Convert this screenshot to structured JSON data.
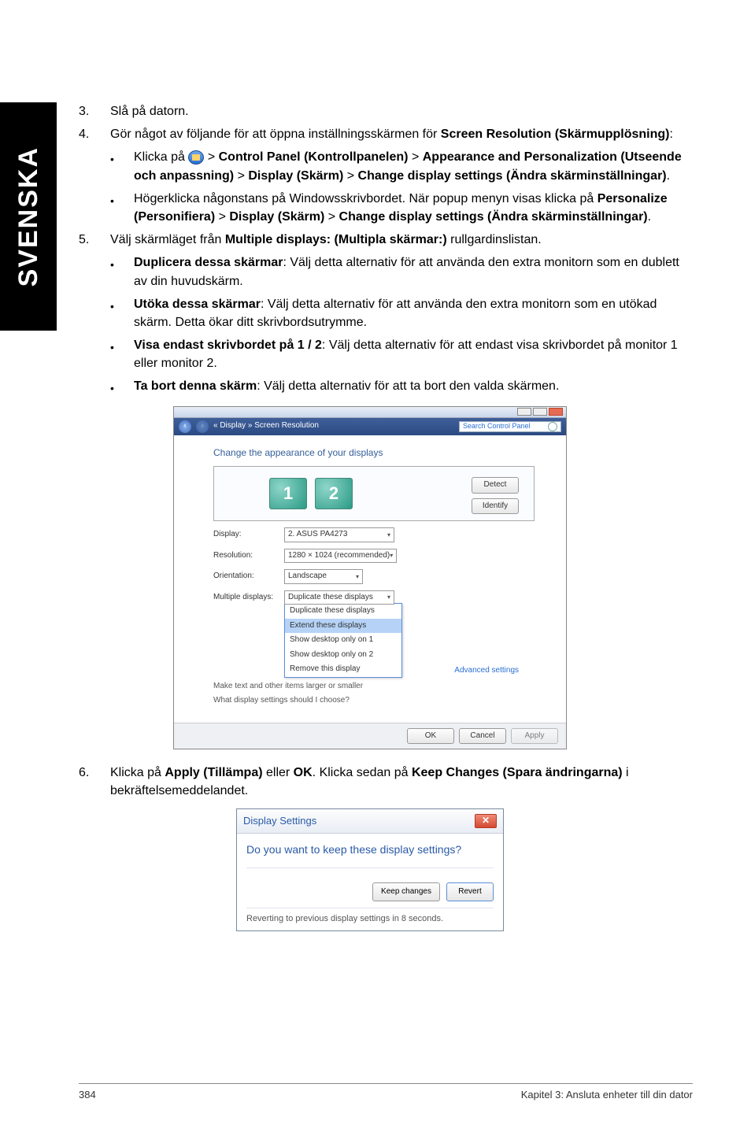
{
  "side_label": "SVENSKA",
  "list": {
    "n3": "3.",
    "t3": "Slå på datorn.",
    "n4": "4.",
    "t4_a": "Gör något av följande för att öppna inställningsskärmen för ",
    "t4_b": "Screen Resolution (Skärmupplösning)",
    "t4_c": ":",
    "b4_1_a": "Klicka på ",
    "b4_1_b": " > ",
    "b4_1_c": "Control Panel (Kontrollpanelen)",
    "b4_1_d": " > ",
    "b4_1_e": "Appearance and Personalization (Utseende och anpassning)",
    "b4_1_f": " > ",
    "b4_1_g": "Display (Skärm)",
    "b4_1_h": " > ",
    "b4_1_i": "Change display settings (Ändra skärminställningar)",
    "b4_1_j": ".",
    "b4_2_a": "Högerklicka någonstans på Windowsskrivbordet. När popup menyn visas klicka på ",
    "b4_2_b": "Personalize (Personifiera)",
    "b4_2_c": " > ",
    "b4_2_d": "Display (Skärm)",
    "b4_2_e": " > ",
    "b4_2_f": "Change display settings (Ändra skärminställningar)",
    "b4_2_g": ".",
    "n5": "5.",
    "t5_a": "Välj skärmläget från ",
    "t5_b": "Multiple displays: (Multipla skärmar:)",
    "t5_c": " rullgardinslistan.",
    "b5_1_a": "Duplicera dessa skärmar",
    "b5_1_b": ": Välj detta alternativ för att använda den extra monitorn som en dublett av din huvudskärm.",
    "b5_2_a": "Utöka dessa skärmar",
    "b5_2_b": ": Välj detta alternativ för att använda den extra monitorn som en utökad skärm. Detta ökar ditt skrivbordsutrymme.",
    "b5_3_a": "Visa endast skrivbordet på 1 / 2",
    "b5_3_b": ": Välj detta alternativ för att endast visa skrivbordet på monitor 1 eller monitor 2.",
    "b5_4_a": "Ta bort denna skärm",
    "b5_4_b": ": Välj detta alternativ för att ta bort den valda skärmen.",
    "n6": "6.",
    "t6_a": "Klicka på ",
    "t6_b": "Apply (Tillämpa)",
    "t6_c": " eller ",
    "t6_d": "OK",
    "t6_e": ". Klicka sedan på ",
    "t6_f": "Keep Changes (Spara ändringarna)",
    "t6_g": " i bekräftelsemeddelandet."
  },
  "scr": {
    "nav_path": "« Display » Screen Resolution",
    "search_ph": "Search Control Panel",
    "heading": "Change the appearance of your displays",
    "mon1": "1",
    "mon2": "2",
    "btn_detect": "Detect",
    "btn_identify": "Identify",
    "lbl_display": "Display:",
    "val_display": "2. ASUS PA4273",
    "lbl_resolution": "Resolution:",
    "val_resolution": "1280 × 1024 (recommended)",
    "lbl_orientation": "Orientation:",
    "val_orientation": "Landscape",
    "lbl_multiple": "Multiple displays:",
    "dd_items": [
      "Duplicate these displays",
      "Duplicate these displays",
      "Extend these displays",
      "Show desktop only on 1",
      "Show desktop only on 2",
      "Remove this display"
    ],
    "link_adv": "Advanced settings",
    "note1": "Make text and other items larger or smaller",
    "note2": "What display settings should I choose?",
    "btn_ok": "OK",
    "btn_cancel": "Cancel",
    "btn_apply": "Apply"
  },
  "keep": {
    "title": "Display Settings",
    "question": "Do you want to keep these display settings?",
    "btn_keep": "Keep changes",
    "btn_revert": "Revert",
    "foot": "Reverting to previous display settings in 8 seconds."
  },
  "footer": {
    "page": "384",
    "chapter": "Kapitel 3: Ansluta enheter till din dator"
  }
}
